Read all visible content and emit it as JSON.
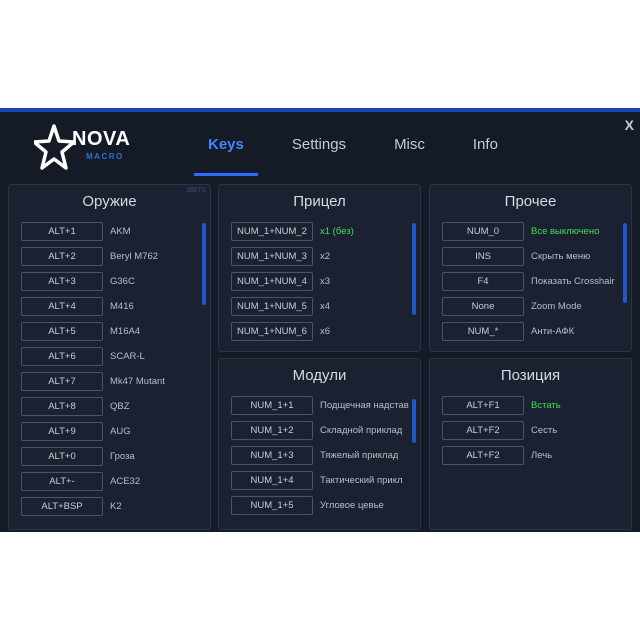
{
  "app": {
    "logo_main": "NOVA",
    "logo_sub": "MACRO",
    "close_label": "X"
  },
  "tabs": [
    {
      "label": "Keys"
    },
    {
      "label": "Settings"
    },
    {
      "label": "Misc"
    },
    {
      "label": "Info"
    }
  ],
  "weapons": {
    "title": "Оружие",
    "tag": "ЗВЕТО",
    "rows": [
      {
        "key": "ALT+1",
        "name": "AKM"
      },
      {
        "key": "ALT+2",
        "name": "Beryl M762"
      },
      {
        "key": "ALT+3",
        "name": "G36C"
      },
      {
        "key": "ALT+4",
        "name": "M416"
      },
      {
        "key": "ALT+5",
        "name": "M16A4"
      },
      {
        "key": "ALT+6",
        "name": "SCAR-L"
      },
      {
        "key": "ALT+7",
        "name": "Mk47 Mutant"
      },
      {
        "key": "ALT+8",
        "name": "QBZ"
      },
      {
        "key": "ALT+9",
        "name": "AUG"
      },
      {
        "key": "ALT+0",
        "name": "Гроза"
      },
      {
        "key": "ALT+-",
        "name": "ACE32"
      },
      {
        "key": "ALT+BSP",
        "name": "K2"
      }
    ]
  },
  "scope": {
    "title": "Прицел",
    "rows": [
      {
        "key": "NUM_1+NUM_2",
        "name": "x1 (без)"
      },
      {
        "key": "NUM_1+NUM_3",
        "name": "x2"
      },
      {
        "key": "NUM_1+NUM_4",
        "name": "x3"
      },
      {
        "key": "NUM_1+NUM_5",
        "name": "x4"
      },
      {
        "key": "NUM_1+NUM_6",
        "name": "x6"
      }
    ]
  },
  "modules": {
    "title": "Модули",
    "rows": [
      {
        "key": "NUM_1+1",
        "name": "Подщечная надстав"
      },
      {
        "key": "NUM_1+2",
        "name": "Складной приклад"
      },
      {
        "key": "NUM_1+3",
        "name": "Тяжелый приклад"
      },
      {
        "key": "NUM_1+4",
        "name": "Тактический прикл"
      },
      {
        "key": "NUM_1+5",
        "name": "Угловое цевье"
      }
    ]
  },
  "other": {
    "title": "Прочее",
    "rows": [
      {
        "key": "NUM_0",
        "name": "Все выключено"
      },
      {
        "key": "INS",
        "name": "Скрыть меню"
      },
      {
        "key": "F4",
        "name": "Показать Crosshair"
      },
      {
        "key": "None",
        "name": "Zoom Mode"
      },
      {
        "key": "NUM_*",
        "name": "Анти-АФК"
      }
    ]
  },
  "position": {
    "title": "Позиция",
    "rows": [
      {
        "key": "ALT+F1",
        "name": "Встать"
      },
      {
        "key": "ALT+F2",
        "name": "Сесть"
      },
      {
        "key": "ALT+F2",
        "name": "Лечь"
      }
    ]
  },
  "colors": {
    "background": "#141a26",
    "panel": "#1b2130",
    "accent": "#2e6bff",
    "active_text": "#3ee05a"
  }
}
